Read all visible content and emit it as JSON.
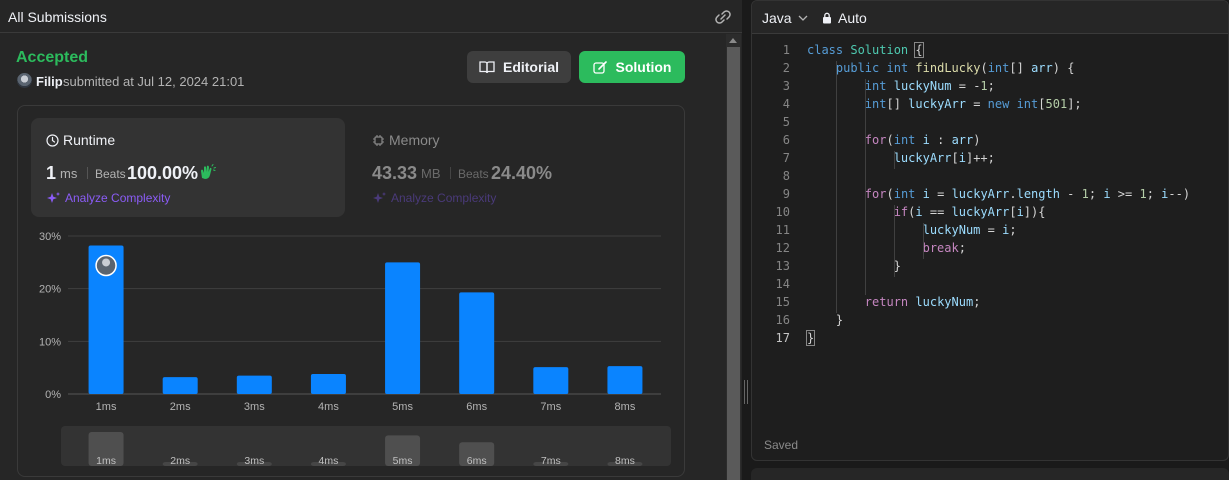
{
  "left": {
    "header_title": "All Submissions",
    "status": "Accepted",
    "submitter": "Filip",
    "submitted_text": "submitted at Jul 12, 2024 21:01",
    "editorial_label": "Editorial",
    "solution_label": "Solution",
    "runtime": {
      "label": "Runtime",
      "value": "1",
      "unit": "ms",
      "beats_label": "Beats",
      "beats_value": "100.00%",
      "analyze_label": "Analyze Complexity"
    },
    "memory": {
      "label": "Memory",
      "value": "43.33",
      "unit": "MB",
      "beats_label": "Beats",
      "beats_value": "24.40%",
      "analyze_label": "Analyze Complexity"
    }
  },
  "chart_data": {
    "type": "bar",
    "categories": [
      "1ms",
      "2ms",
      "3ms",
      "4ms",
      "5ms",
      "6ms",
      "7ms",
      "8ms"
    ],
    "values": [
      28.2,
      3.2,
      3.5,
      3.8,
      25.0,
      19.3,
      5.1,
      5.3
    ],
    "ylim": [
      0,
      30
    ],
    "yticks": [
      "0%",
      "10%",
      "20%",
      "30%"
    ],
    "ytick_values": [
      0,
      10,
      20,
      30
    ],
    "highlight_index": 0,
    "grid": true,
    "bar_color": "#0a84ff",
    "navigator_values": [
      1.0,
      0.04,
      0.04,
      0.04,
      0.9,
      0.7,
      0.04,
      0.04
    ]
  },
  "right": {
    "language": "Java",
    "mode": "Auto",
    "status": "Saved",
    "active_line": 17,
    "line_numbers": [
      "1",
      "2",
      "3",
      "4",
      "5",
      "6",
      "7",
      "8",
      "9",
      "10",
      "11",
      "12",
      "13",
      "14",
      "15",
      "16",
      "17"
    ]
  },
  "colors": {
    "accepted": "#2cbb5d",
    "solution_button": "#2cbb5d",
    "bar": "#0a84ff",
    "analyze": "#8b5cf6"
  }
}
